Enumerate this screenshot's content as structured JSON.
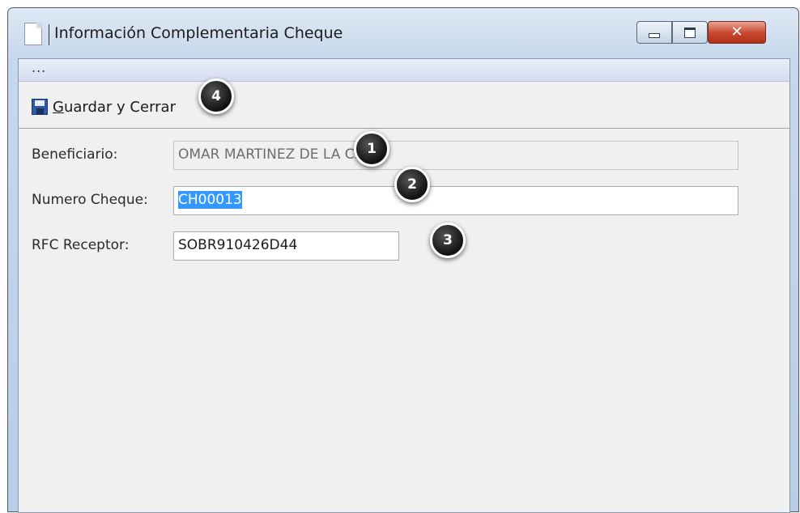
{
  "window": {
    "title": "Información Complementaria Cheque",
    "close_glyph": "✕"
  },
  "menubar": {
    "overflow": "..."
  },
  "toolbar": {
    "save_icon": "floppy-disk-icon",
    "save_label_accel": "G",
    "save_label_rest": "uardar y Cerrar"
  },
  "form": {
    "beneficiario_label": "Beneficiario:",
    "beneficiario_value": "OMAR MARTINEZ DE LA CRUZ",
    "numero_label": "Numero Cheque:",
    "numero_value": "CH00013",
    "rfc_label": "RFC Receptor:",
    "rfc_value": "SOBR910426D44"
  },
  "callouts": [
    "1",
    "2",
    "3",
    "4"
  ],
  "colors": {
    "selection": "#3399ff",
    "close_button": "#c8442c"
  }
}
